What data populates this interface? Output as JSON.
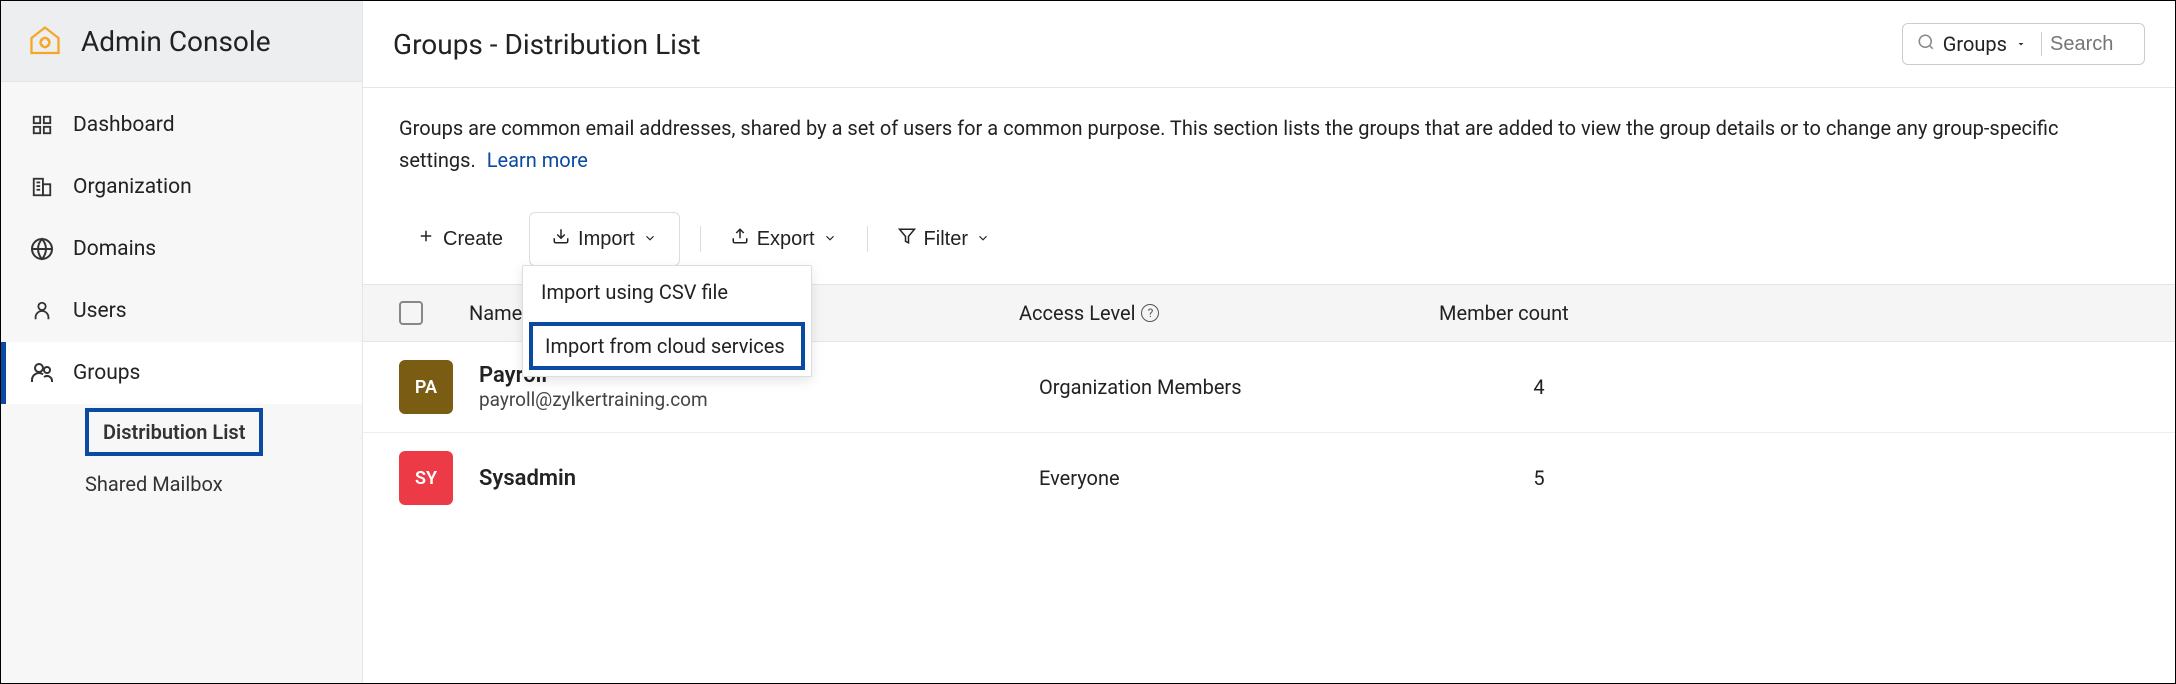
{
  "app_title": "Admin Console",
  "sidebar": {
    "items": [
      {
        "label": "Dashboard"
      },
      {
        "label": "Organization"
      },
      {
        "label": "Domains"
      },
      {
        "label": "Users"
      },
      {
        "label": "Groups"
      }
    ],
    "sub_items": [
      {
        "label": "Distribution List"
      },
      {
        "label": "Shared Mailbox"
      }
    ]
  },
  "header": {
    "title": "Groups - Distribution List",
    "search_scope": "Groups",
    "search_placeholder": "Search"
  },
  "description": {
    "text": "Groups are common email addresses, shared by a set of users for a common purpose. This section lists the groups that are added to view the group details or to change any group-specific settings.",
    "learn_more": "Learn more"
  },
  "toolbar": {
    "create_label": "Create",
    "import_label": "Import",
    "export_label": "Export",
    "filter_label": "Filter",
    "import_menu": [
      "Import using CSV file",
      "Import from cloud services"
    ]
  },
  "table": {
    "columns": {
      "name": "Name",
      "access": "Access Level",
      "members": "Member count"
    },
    "rows": [
      {
        "avatar_text": "PA",
        "avatar_class": "pa",
        "name": "Payroll",
        "email": "payroll@zylkertraining.com",
        "access": "Organization Members",
        "count": "4"
      },
      {
        "avatar_text": "SY",
        "avatar_class": "sy",
        "name": "Sysadmin",
        "email": "",
        "access": "Everyone",
        "count": "5"
      }
    ]
  }
}
